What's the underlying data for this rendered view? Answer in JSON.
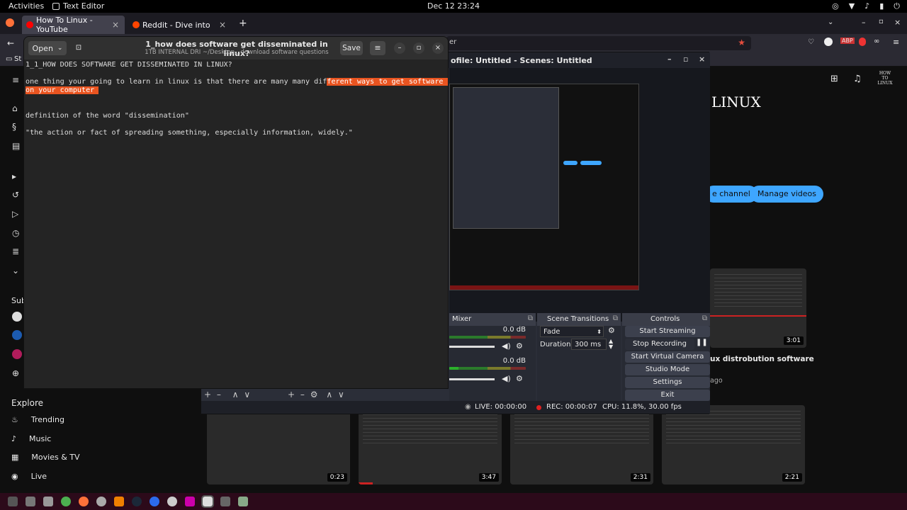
{
  "topbar": {
    "activities": "Activities",
    "app_name": "Text Editor",
    "clock": "Dec 12  23:24"
  },
  "firefox": {
    "tabs": [
      {
        "label": "How To Linux - YouTube",
        "favicon_color": "#ff0000"
      },
      {
        "label": "Reddit - Dive into anythin",
        "favicon_color": "#ff4500"
      }
    ],
    "new_tab": "+",
    "url_fragment": "er",
    "bookmark_prefix": "St"
  },
  "youtube": {
    "sidebar_subs": "Sub",
    "explore": {
      "title": "Explore",
      "items": [
        "Trending",
        "Music",
        "Movies & TV",
        "Live"
      ]
    },
    "channel_logo": "LINUX",
    "small_logo": [
      "HOW",
      "TO",
      "LINUX"
    ],
    "customize_button": "e channel",
    "manage_button": "Manage videos",
    "video_title_fragment": "ux distrobution software",
    "video_meta_fragment": "ago",
    "durations": {
      "top": "3:01",
      "v1": "0:23",
      "v2": "3:47",
      "v3": "2:31",
      "v4": "2:21"
    }
  },
  "obs": {
    "title": "ofile: Untitled - Scenes: Untitled",
    "mixer": {
      "title": "Mixer",
      "db1": "0.0 dB",
      "db2": "0.0 dB"
    },
    "transitions": {
      "title": "Scene Transitions",
      "type": "Fade",
      "duration_label": "Duration",
      "duration_value": "300 ms"
    },
    "controls": {
      "title": "Controls",
      "buttons": [
        "Start Streaming",
        "Stop Recording",
        "Start Virtual Camera",
        "Studio Mode",
        "Settings",
        "Exit"
      ]
    },
    "status": {
      "live": "LIVE: 00:00:00",
      "rec": "REC: 00:00:07",
      "cpu": "CPU: 11.8%, 30.00 fps"
    }
  },
  "editor": {
    "open_label": "Open",
    "title": "1_how does software get disseminated in linux?",
    "subtitle": "1TB INTERNAL DRI ~/Desktop…download software questions",
    "save_label": "Save",
    "lines": {
      "l1": "1_1_HOW DOES SOFTWARE GET DISSEMINATED IN LINUX?",
      "l2_plain": "one thing your going to learn in linux is that there are many many dif",
      "l2_selected": "ferent ways to get software ",
      "l3_selected": "on your computer ",
      "l4": "definition of the word \"dissemination\"",
      "l5": "\"the action or fact of spreading something, especially information, widely.\""
    }
  },
  "colors": {
    "selection": "#e95420",
    "youtube_blue": "#3ea6ff",
    "rec_red": "#e02020"
  }
}
